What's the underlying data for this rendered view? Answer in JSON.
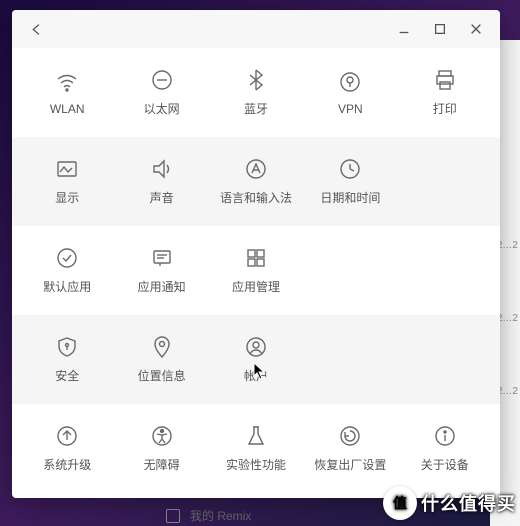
{
  "titlebar": {
    "back_label": "back",
    "minimize_label": "minimize",
    "maximize_label": "maximize",
    "close_label": "close"
  },
  "sections": [
    {
      "tiles": [
        {
          "icon": "wifi-icon",
          "label": "WLAN"
        },
        {
          "icon": "ethernet-icon",
          "label": "以太网"
        },
        {
          "icon": "bluetooth-icon",
          "label": "蓝牙"
        },
        {
          "icon": "vpn-icon",
          "label": "VPN"
        },
        {
          "icon": "print-icon",
          "label": "打印"
        }
      ]
    },
    {
      "tiles": [
        {
          "icon": "display-icon",
          "label": "显示"
        },
        {
          "icon": "sound-icon",
          "label": "声音"
        },
        {
          "icon": "language-input-icon",
          "label": "语言和输入法"
        },
        {
          "icon": "clock-icon",
          "label": "日期和时间"
        }
      ]
    },
    {
      "tiles": [
        {
          "icon": "check-circle-icon",
          "label": "默认应用"
        },
        {
          "icon": "notification-icon",
          "label": "应用通知"
        },
        {
          "icon": "apps-grid-icon",
          "label": "应用管理"
        }
      ]
    },
    {
      "tiles": [
        {
          "icon": "shield-icon",
          "label": "安全"
        },
        {
          "icon": "location-icon",
          "label": "位置信息"
        },
        {
          "icon": "account-icon",
          "label": "帐户"
        }
      ]
    },
    {
      "tiles": [
        {
          "icon": "upgrade-icon",
          "label": "系统升级"
        },
        {
          "icon": "accessibility-icon",
          "label": "无障碍"
        },
        {
          "icon": "flask-icon",
          "label": "实验性功能"
        },
        {
          "icon": "factory-reset-icon",
          "label": "恢复出厂设置"
        },
        {
          "icon": "about-icon",
          "label": "关于设备"
        }
      ]
    }
  ],
  "bottom_peek": {
    "label": "我的 Remix"
  },
  "bg_items": [
    "2…2",
    "2…2",
    "2…2"
  ],
  "watermark": {
    "badge": "值",
    "text": "什么值得买"
  }
}
